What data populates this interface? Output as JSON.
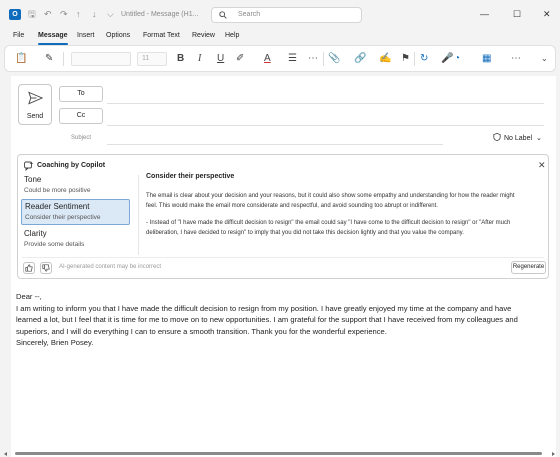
{
  "window": {
    "app_badge": "O",
    "title": "Untitled - Message (H1...",
    "search_placeholder": "Search",
    "controls": {
      "minimize": "—",
      "maximize": "☐",
      "close": "✕"
    }
  },
  "quick_access": {
    "save": "🖫",
    "undo": "↶",
    "redo": "↷",
    "up": "↑",
    "down": "↓",
    "more": "⌵"
  },
  "menu": {
    "items": [
      "File",
      "Message",
      "Insert",
      "Options",
      "Format Text",
      "Review",
      "Help"
    ],
    "active": "Message"
  },
  "ribbon": {
    "paste": "📋",
    "format_painter": "✎",
    "font_size": "11",
    "bold": "B",
    "italic": "I",
    "underline": "U",
    "highlight": "✐",
    "font_color": "A",
    "list": "☰",
    "more": "⋯",
    "attach": "📎",
    "link": "🔗",
    "signature": "✍",
    "flag": "⚑",
    "loop": "↻",
    "dictate": "🎤",
    "copilot": "◔",
    "apps": "▦"
  },
  "compose": {
    "send_label": "Send",
    "to_label": "To",
    "cc_label": "Cc",
    "subject_label": "Subject",
    "sensitivity_label": "No Label",
    "dropdown_chevron": "⌄"
  },
  "copilot": {
    "header": "Coaching by Copilot",
    "close": "✕",
    "items": [
      {
        "title": "Tone",
        "subtitle": "Could be more positive"
      },
      {
        "title": "Reader Sentiment",
        "subtitle": "Consider their perspective"
      },
      {
        "title": "Clarity",
        "subtitle": "Provide some details"
      }
    ],
    "selected_index": 1,
    "detail_title": "Consider their perspective",
    "detail_p1": [
      "The email is clear about your decision and your reasons, but it could also show some empathy and understanding for how the reader might",
      "feel. This would make the email more considerate and respectful, and avoid sounding too abrupt or indifferent."
    ],
    "detail_p2": [
      "- Instead of \"I have made the difficult decision to resign\" the email could say \"I have come to the difficult decision to resign\" or \"After much",
      "deliberation, I have decided to resign\" to imply that you did not take this decision lightly and that you value the company."
    ],
    "disclaimer": "AI-generated content may be incorrect",
    "regenerate_label": "Regenerate"
  },
  "email_body": {
    "lines": [
      "Dear --,",
      "I am writing to inform you that I have made the difficult decision to resign from my position. I have greatly enjoyed my time at the company and have",
      "learned a lot, but I feel that it is time for me to move on to new opportunities. I am grateful for the support that I have received from my colleagues and",
      "superiors, and I will do everything I can to ensure a smooth transition. Thank you for the wonderful experience.",
      "Sincerely, Brien Posey."
    ]
  }
}
